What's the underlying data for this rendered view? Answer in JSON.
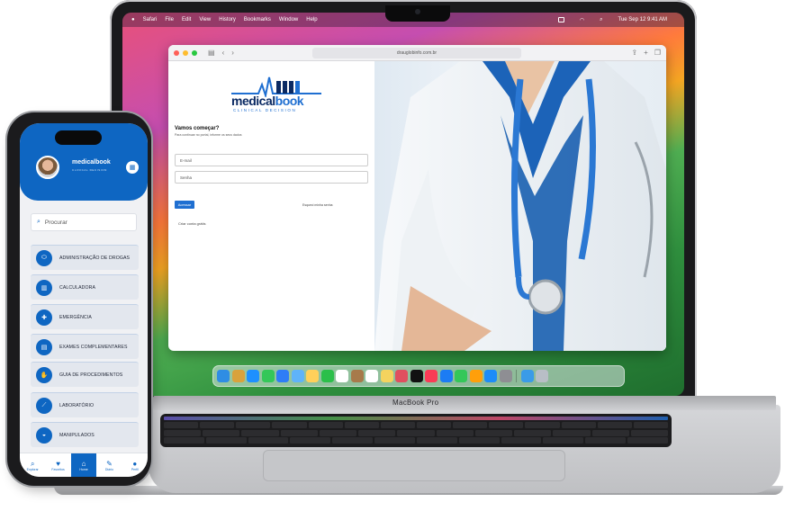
{
  "menubar": {
    "items": [
      "Safari",
      "File",
      "Edit",
      "View",
      "History",
      "Bookmarks",
      "Window",
      "Help"
    ],
    "clock": "Tue Sep 12  9:41 AM"
  },
  "browser": {
    "url": "drauglobinfo.com.br"
  },
  "login": {
    "logo_text_a": "medical",
    "logo_text_b": "book",
    "logo_sub": "CLINICAL DECISION",
    "title": "Vamos começar?",
    "subtitle": "Para continuar no portal, informe os seus dados",
    "email_placeholder": "E-mail",
    "password_placeholder": "Senha",
    "submit_label": "Acessar",
    "forgot_label": "Esqueci minha senha",
    "signup_label": "Criar conta grátis"
  },
  "laptop": {
    "brand": "MacBook Pro"
  },
  "phone": {
    "logo_text": "medicalbook",
    "logo_sub": "CLINICAL DECISION",
    "search_placeholder": "Procurar",
    "menu": [
      {
        "label": "ADMINISTRAÇÃO DE DROGAS",
        "icon": "pill-icon"
      },
      {
        "label": "CALCULADORA",
        "icon": "calculator-icon"
      },
      {
        "label": "EMERGÊNCIA",
        "icon": "emergency-icon"
      },
      {
        "label": "EXAMES COMPLEMENTARES",
        "icon": "document-icon"
      },
      {
        "label": "GUIA DE PROCEDIMENTOS",
        "icon": "hand-icon"
      },
      {
        "label": "LABORATÓRIO",
        "icon": "test-tube-icon"
      },
      {
        "label": "MANIPULADOS",
        "icon": "mortar-icon"
      }
    ],
    "tabs": [
      {
        "label": "Explorar",
        "icon": "search-icon"
      },
      {
        "label": "Favoritos",
        "icon": "heart-icon"
      },
      {
        "label": "Home",
        "icon": "home-icon"
      },
      {
        "label": "Diário",
        "icon": "notebook-icon"
      },
      {
        "label": "Perfil",
        "icon": "user-icon"
      }
    ]
  },
  "colors": {
    "brand_blue": "#0e66c2",
    "logo_navy": "#0b2a63"
  }
}
